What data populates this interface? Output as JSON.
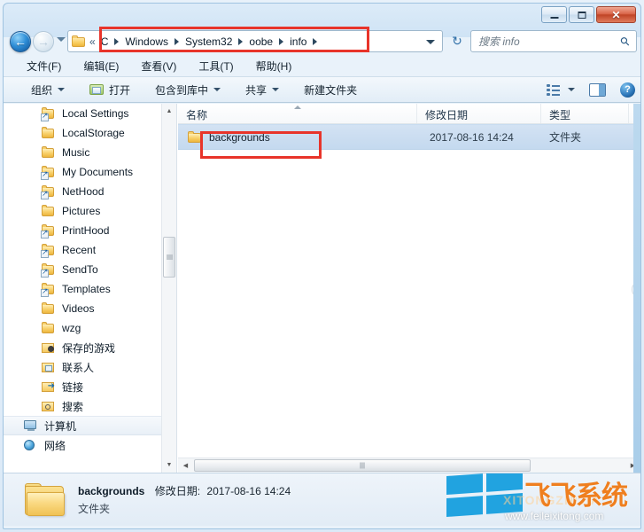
{
  "window": {
    "controls": {
      "minimize": "minimize-button",
      "maximize": "maximize-button",
      "close": "✕"
    }
  },
  "navigation": {
    "back_glyph": "←",
    "forward_glyph": "→",
    "refresh_glyph": "↻",
    "breadcrumbs": [
      "C",
      "Windows",
      "System32",
      "oobe",
      "info"
    ]
  },
  "search": {
    "placeholder": "搜索 info",
    "icon": "search-icon"
  },
  "menubar": {
    "items": [
      {
        "label": "文件(F)"
      },
      {
        "label": "编辑(E)"
      },
      {
        "label": "查看(V)"
      },
      {
        "label": "工具(T)"
      },
      {
        "label": "帮助(H)"
      }
    ]
  },
  "toolbar": {
    "organize": "组织",
    "open": "打开",
    "include_in_library": "包含到库中",
    "share": "共享",
    "new_folder": "新建文件夹",
    "help_glyph": "?"
  },
  "navpane": {
    "items": [
      {
        "label": "Local Settings",
        "icon": "folder-shortcut-icon",
        "indent": 2
      },
      {
        "label": "LocalStorage",
        "icon": "folder-icon",
        "indent": 2
      },
      {
        "label": "Music",
        "icon": "folder-icon",
        "indent": 2
      },
      {
        "label": "My Documents",
        "icon": "folder-shortcut-icon",
        "indent": 2
      },
      {
        "label": "NetHood",
        "icon": "folder-shortcut-icon",
        "indent": 2
      },
      {
        "label": "Pictures",
        "icon": "folder-icon",
        "indent": 2
      },
      {
        "label": "PrintHood",
        "icon": "folder-shortcut-icon",
        "indent": 2
      },
      {
        "label": "Recent",
        "icon": "folder-shortcut-icon",
        "indent": 2
      },
      {
        "label": "SendTo",
        "icon": "folder-shortcut-icon",
        "indent": 2
      },
      {
        "label": "Templates",
        "icon": "folder-shortcut-icon",
        "indent": 2
      },
      {
        "label": "Videos",
        "icon": "folder-icon",
        "indent": 2
      },
      {
        "label": "wzg",
        "icon": "folder-icon",
        "indent": 2
      },
      {
        "label": "保存的游戏",
        "icon": "saved-games-folder-icon",
        "indent": 2
      },
      {
        "label": "联系人",
        "icon": "contacts-folder-icon",
        "indent": 2
      },
      {
        "label": "链接",
        "icon": "links-folder-icon",
        "indent": 2
      },
      {
        "label": "搜索",
        "icon": "searches-folder-icon",
        "indent": 2
      },
      {
        "label": "计算机",
        "icon": "computer-icon",
        "indent": 1
      },
      {
        "label": "网络",
        "icon": "network-icon",
        "indent": 1
      }
    ]
  },
  "filelist": {
    "columns": [
      {
        "label": "名称",
        "sorted": true
      },
      {
        "label": "修改日期",
        "sorted": false
      },
      {
        "label": "类型",
        "sorted": false
      }
    ],
    "rows": [
      {
        "name": "backgrounds",
        "date_modified": "2017-08-16 14:24",
        "type": "文件夹",
        "icon": "folder-icon",
        "selected": true
      }
    ]
  },
  "details": {
    "name": "backgrounds",
    "date_label": "修改日期:",
    "date_value": "2017-08-16 14:24",
    "type": "文件夹"
  },
  "watermark": {
    "brand": "飞飞系统",
    "url": "www.feileixitong.com",
    "ghost": "XITONGZHIJIA"
  },
  "colors": {
    "annotation_red": "#e8342a",
    "selection_blue": "#c4d9ef",
    "accent_blue": "#2f8fd8",
    "watermark_orange": "#ef7f1f",
    "watermark_logo_blue": "#21a3e0"
  }
}
